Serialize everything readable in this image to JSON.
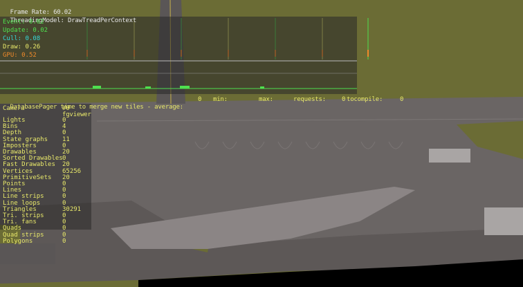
{
  "header": {
    "frame_rate_label": "Frame Rate:",
    "frame_rate_value": "60.02",
    "threading_label": "ThreadingModel:",
    "threading_value": "DrawTreadPerContext"
  },
  "stats": [
    {
      "label": "Event:",
      "value": "0.02",
      "color": "#4fe04f"
    },
    {
      "label": "Update:",
      "value": "0.02",
      "color": "#4fe04f"
    },
    {
      "label": "Cull:",
      "value": "0.08",
      "color": "#35d6d6"
    },
    {
      "label": "Draw:",
      "value": "0.26",
      "color": "#e8e86a"
    },
    {
      "label": "GPU:",
      "value": "0.52",
      "color": "#f08a2a"
    }
  ],
  "pager": {
    "label": "DatabasePager time to merge new tiles - average:",
    "average": "0",
    "min_label": "min:",
    "max_label": "max:",
    "requests_label": "requests:",
    "requests_value": "0",
    "tocompile_label": "tocompile:",
    "tocompile_value": "0"
  },
  "camera": {
    "header_label": "Camera",
    "id": "#0",
    "name": "fgviewer"
  },
  "scene_stats": [
    {
      "label": "Lights",
      "value": "0"
    },
    {
      "label": "Bins",
      "value": "4"
    },
    {
      "label": "Depth",
      "value": "0"
    },
    {
      "label": "State graphs",
      "value": "11"
    },
    {
      "label": "Imposters",
      "value": "0"
    },
    {
      "label": "Drawables",
      "value": "20"
    },
    {
      "label": "Sorted Drawables",
      "value": "0"
    },
    {
      "label": "Fast Drawables",
      "value": "20"
    },
    {
      "label": "Vertices",
      "value": "65256"
    },
    {
      "label": "PrimitiveSets",
      "value": "20"
    },
    {
      "label": "Points",
      "value": "0"
    },
    {
      "label": "Lines",
      "value": "0"
    },
    {
      "label": "Line strips",
      "value": "0"
    },
    {
      "label": "Line loops",
      "value": "0"
    },
    {
      "label": "Triangles",
      "value": "30291"
    },
    {
      "label": "Tri. strips",
      "value": "0"
    },
    {
      "label": "Tri. fans",
      "value": "0"
    },
    {
      "label": "Quads",
      "value": "0"
    },
    {
      "label": "Quad strips",
      "value": "0"
    },
    {
      "label": "Polygons",
      "value": "0"
    }
  ],
  "colors": {
    "grass": "#6b6c35",
    "tarmac": "#6a6564",
    "taxi_line": "#c8b24a",
    "event_bar": "#4fe04f",
    "cull_bar": "#35d6d6",
    "draw_bar": "#e8e86a",
    "gpu_bar": "#f08a2a"
  }
}
